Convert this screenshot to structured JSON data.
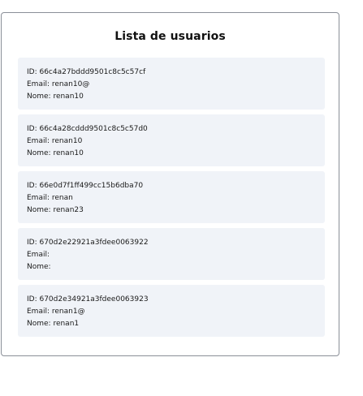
{
  "page": {
    "title": "Lista de usuarios"
  },
  "labels": {
    "id": "ID: ",
    "email": "Email: ",
    "nome": "Nome: "
  },
  "users": [
    {
      "id": "66c4a27bddd9501c8c5c57cf",
      "email": "renan10@",
      "nome": "renan10"
    },
    {
      "id": "66c4a28cddd9501c8c5c57d0",
      "email": "renan10",
      "nome": "renan10"
    },
    {
      "id": "66e0d7f1ff499cc15b6dba70",
      "email": "renan",
      "nome": "renan23"
    },
    {
      "id": "670d2e22921a3fdee0063922",
      "email": "",
      "nome": ""
    },
    {
      "id": "670d2e34921a3fdee0063923",
      "email": "renan1@",
      "nome": "renan1"
    }
  ],
  "colors": {
    "card_border": "#8a8f98",
    "item_background": "#f0f3f8",
    "text": "#1a1a1a"
  }
}
